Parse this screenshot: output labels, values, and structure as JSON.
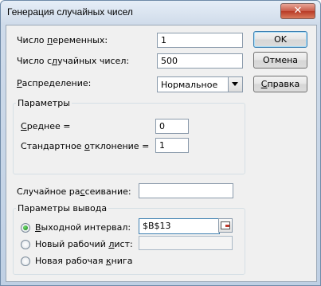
{
  "window": {
    "title": "Генерация случайных чисел",
    "close_glyph": "✕"
  },
  "fields": {
    "num_variables": {
      "label_pre": "Число ",
      "label_key": "п",
      "label_post": "еременных:",
      "value": "1"
    },
    "num_random": {
      "label_pre": "Число с",
      "label_key": "л",
      "label_post": "учайных чисел:",
      "value": "500"
    },
    "distribution": {
      "label_pre": "",
      "label_key": "Р",
      "label_post": "аспределение:",
      "value": "Нормальное"
    }
  },
  "buttons": {
    "ok": "OK",
    "cancel": "Отмена",
    "help_key": "С",
    "help_rest": "правка"
  },
  "params_group": {
    "title": "Параметры",
    "mean": {
      "label_pre": "",
      "label_key": "С",
      "label_post": "реднее =",
      "value": "0"
    },
    "stddev": {
      "label_pre": "Стандартное ",
      "label_key": "о",
      "label_post": "тклонение =",
      "value": "1"
    }
  },
  "random_seed": {
    "label_pre": "Случайное ра",
    "label_key": "с",
    "label_post": "сеивание:",
    "value": ""
  },
  "output_group": {
    "title": "Параметры вывода",
    "output_range": {
      "label_pre": "",
      "label_key": "В",
      "label_post": "ыходной интервал:",
      "value": "$B$13",
      "checked": true
    },
    "new_sheet": {
      "label_pre": "Новый рабочий ",
      "label_key": "л",
      "label_post": "ист:",
      "value": "",
      "checked": false
    },
    "new_workbook": {
      "label_pre": "Новая рабочая ",
      "label_key": "к",
      "label_post": "нига",
      "checked": false
    }
  }
}
